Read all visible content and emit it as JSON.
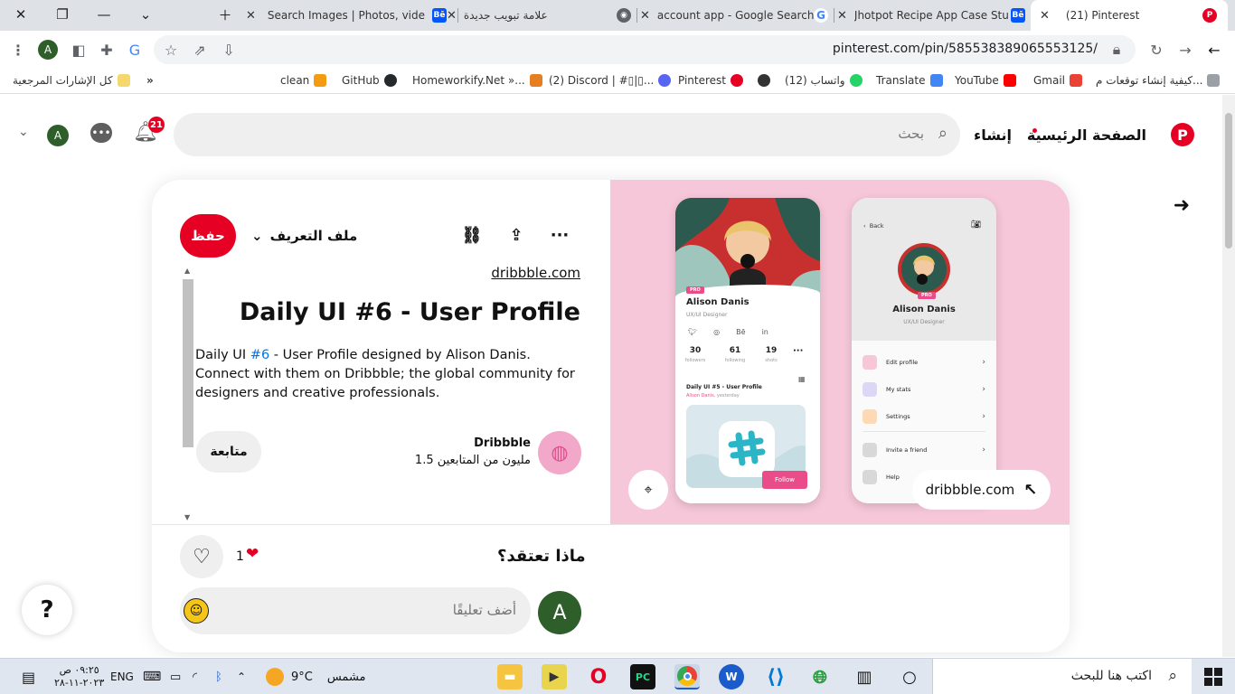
{
  "browser": {
    "tabs": [
      {
        "title": "Search Images | Photos, vide",
        "favicon": "Bē",
        "color": "#0057ff"
      },
      {
        "title": "علامة تبويب جديدة",
        "favicon": "◉",
        "color": "#5f6368"
      },
      {
        "title": "account app - Google Search",
        "favicon": "G",
        "color": "#4285f4"
      },
      {
        "title": "Jhotpot Recipe App Case Stu",
        "favicon": "Bē",
        "color": "#0057ff"
      },
      {
        "title": "(21) Pinterest",
        "favicon": "P",
        "color": "#e60023"
      }
    ],
    "url": "pinterest.com/pin/585538389065553125/",
    "bookmarks": [
      {
        "label": "كيفية إنشاء توقعات م...",
        "color": "#9aa0a6"
      },
      {
        "label": "Gmail",
        "color": "#ea4335"
      },
      {
        "label": "YouTube",
        "color": "#ff0000"
      },
      {
        "label": "Translate",
        "color": "#4285f4"
      },
      {
        "label": "(12) واتساب",
        "color": "#25d366"
      },
      {
        "label": "",
        "color": "#333333"
      },
      {
        "label": "Pinterest",
        "color": "#e60023"
      },
      {
        "label": "(2) Discord | #▯|▯...",
        "color": "#5865f2"
      },
      {
        "label": "Homeworkify.Net »...",
        "color": "#e67e22"
      },
      {
        "label": "GitHub",
        "color": "#24292e"
      },
      {
        "label": "clean",
        "color": "#f39c12"
      }
    ],
    "all_bookmarks": "كل الإشارات المرجعية",
    "more": "»"
  },
  "nav": {
    "home": "الصفحة الرئيسية",
    "create": "إنشاء",
    "search_placeholder": "بحث",
    "notifications": "21",
    "avatar": "A"
  },
  "pin": {
    "save": "حفظ",
    "profile": "ملف التعريف",
    "source": "dribbble.com",
    "title": "Daily UI #6 - User Profile",
    "description_pre": "Daily UI ",
    "description_hash": "#6",
    "description_post": " - User Profile designed by Alison Danis. Connect with them on Dribbble; the global community for designers and creative professionals.",
    "creator_name": "Dribbble",
    "creator_followers": "1.5 مليون من المتابعين",
    "follow": "متابعة",
    "image_link": "dribbble.com"
  },
  "mockup": {
    "pro": "PRO",
    "name": "Alison Danis",
    "role": "UX/UI Designer",
    "stats": [
      {
        "value": "30",
        "label": "followers"
      },
      {
        "value": "61",
        "label": "following"
      },
      {
        "value": "19",
        "label": "shots"
      }
    ],
    "shot_title": "Daily UI #5 - User Profile",
    "shot_by": "Alison Danis",
    "shot_time": ", yesterday",
    "follow": "Follow",
    "back": "Back",
    "menu": [
      {
        "label": "Edit profile",
        "color": "#f7c6d8"
      },
      {
        "label": "My stats",
        "color": "#dcd7f5"
      },
      {
        "label": "Settings",
        "color": "#ffd9b3"
      },
      {
        "label": "Invite a friend",
        "color": "#d8d8d8"
      },
      {
        "label": "Help",
        "color": "#d8d8d8"
      }
    ]
  },
  "comments": {
    "heading": "ماذا تعتقد؟",
    "reaction_count": "1",
    "placeholder": "أضف تعليقًا",
    "avatar": "A"
  },
  "help": "?",
  "taskbar": {
    "search_placeholder": "اكتب هنا للبحث",
    "weather_label": "مشمس",
    "temperature": "9°C",
    "language": "ENG",
    "time": "٠٩:٢٥ ص",
    "date": "٢٠٢٣-١١-٢٨"
  }
}
